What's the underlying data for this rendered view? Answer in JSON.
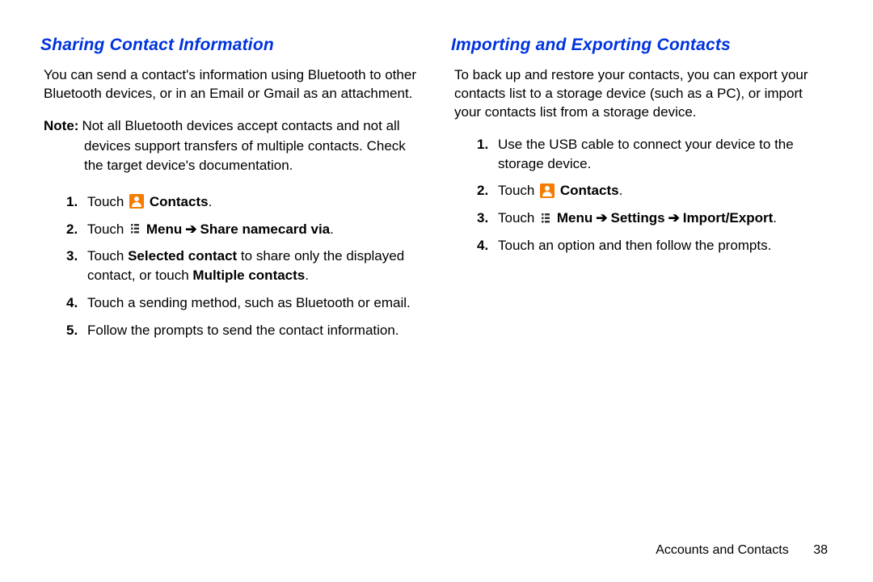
{
  "left": {
    "heading": "Sharing Contact Information",
    "intro": "You can send a contact's information using Bluetooth to other Bluetooth devices, or in an Email or Gmail as an attachment.",
    "note_label": "Note:",
    "note_first": "Not all Bluetooth devices accept contacts and not all",
    "note_rest": "devices support transfers of multiple contacts. Check the target device's documentation.",
    "step1_a": "Touch",
    "step1_b": "Contacts",
    "step1_c": ".",
    "step2_a": "Touch",
    "step2_b": "Menu",
    "step2_c": "Share namecard via",
    "step2_d": ".",
    "step3_a": "Touch ",
    "step3_b": "Selected contact",
    "step3_c": " to share only the displayed contact, or touch ",
    "step3_d": "Multiple contacts",
    "step3_e": ".",
    "step4": "Touch a sending method, such as Bluetooth or email.",
    "step5": "Follow the prompts to send the contact information."
  },
  "right": {
    "heading": "Importing and Exporting Contacts",
    "intro": "To back up and restore your contacts, you can export your contacts list to a storage device (such as a PC), or import your contacts list from a storage device.",
    "step1": "Use the USB cable to connect your device to the storage device.",
    "step2_a": "Touch",
    "step2_b": "Contacts",
    "step2_c": ".",
    "step3_a": "Touch",
    "step3_b": "Menu",
    "step3_c": "Settings",
    "step3_d": "Import/Export",
    "step3_e": ".",
    "step4": "Touch an option and then follow the prompts."
  },
  "arrow": "➔",
  "footer": {
    "section": "Accounts and Contacts",
    "page": "38"
  }
}
